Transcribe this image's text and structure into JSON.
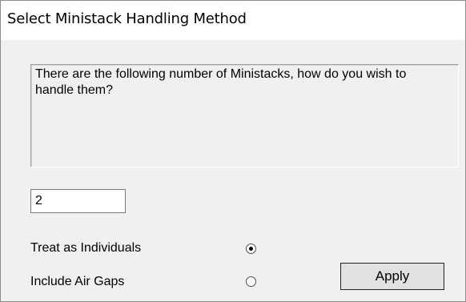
{
  "window": {
    "title": "Select Ministack Handling Method"
  },
  "message": {
    "text": "There are the following number of Ministacks, how do you wish to handle them?"
  },
  "count": {
    "value": "2"
  },
  "options": [
    {
      "label": "Treat as Individuals",
      "selected": true
    },
    {
      "label": "Include Air Gaps",
      "selected": false
    }
  ],
  "buttons": {
    "apply_label": "Apply"
  }
}
